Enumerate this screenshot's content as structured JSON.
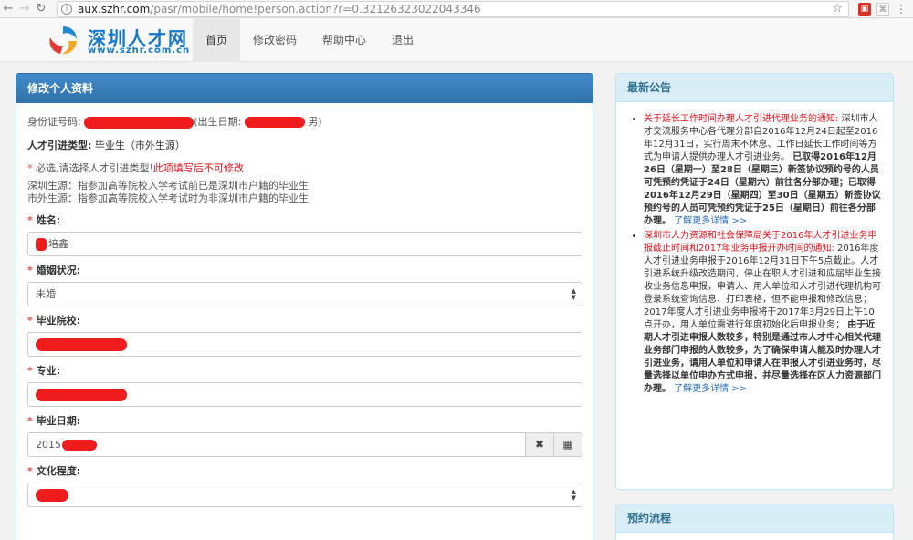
{
  "browser": {
    "url_host": "aux.szhr.com",
    "url_path": "/pasr/mobile/home!person.action?r=0.32126323022043346"
  },
  "site": {
    "logo_title": "深圳人才网",
    "logo_url": "www.szhr.com.cn",
    "menu": [
      "首页",
      "修改密码",
      "帮助中心",
      "退出"
    ]
  },
  "form": {
    "heading": "修改个人资料",
    "id_label": "身份证号码:",
    "birth_label": "(出生日期:",
    "gender": "男)",
    "type_label": "人才引进类型:",
    "type_value": "毕业生（市外生源）",
    "req_star": "*",
    "note": "必选,请选择人才引进类型!",
    "note_warn": "此项填写后不可修改",
    "desc1": "深圳生源：指参加高等院校入学考试前已是深圳市户籍的毕业生",
    "desc2": "市外生源：指参加高等院校入学考试时为非深圳市户籍的毕业生",
    "fields": {
      "name_label": "姓名:",
      "name_value": "培鑫",
      "marital_label": "婚姻状况:",
      "marital_value": "未婚",
      "school_label": "毕业院校:",
      "major_label": "专业:",
      "graddate_label": "毕业日期:",
      "graddate_value": "2015",
      "edu_label": "文化程度:"
    }
  },
  "sidebar": {
    "announce_title": "最新公告",
    "process_title": "预约流程",
    "news1_title": "关于延长工作时间办理人才引进代理业务的通知:",
    "news1_p1": "深圳市人才交流服务中心各代理分部自2016年12月24日起至2016年12月31日，实行周末不休息、工作日延长工作时间等方式为申请人提供办理人才引进业务。",
    "news1_b": "已取得2016年12月26日（星期一）至28日（星期三）新签协议预约号的人员可凭预约凭证于24日（星期六）前往各分部办理；已取得2016年12月29日（星期四）至30日（星期五）新签协议预约号的人员可凭预约凭证于25日（星期日）前往各分部办理。",
    "news2_title": "深圳市人力资源和社会保障局关于2016年人才引进业务申报截止时间和2017年业务申报开办时间的通知:",
    "news2_p1": "2016年度人才引进业务申报于2016年12月31日下午5点截止。人才引进系统升级改造期间，停止在职人才引进和应届毕业生接收业务信息申报，申请人、用人单位和人才引进代理机构可登录系统查询信息、打印表格，但不能申报和修改信息；2017年度人才引进业务申报将于2017年3月29日上午10点开办，用人单位需进行年度初始化后申报业务；",
    "news2_b": "由于近期人才引进申报人数较多，特别是通过市人才中心相关代理业务部门申报的人数较多，为了确保申请人能及时办理人才引进业务，请用人单位和申请人在申报人才引进业务时，尽量选择以单位申办方式申报，并尽量选择在区人力资源部门办理。",
    "more": "了解更多详情 >>"
  }
}
